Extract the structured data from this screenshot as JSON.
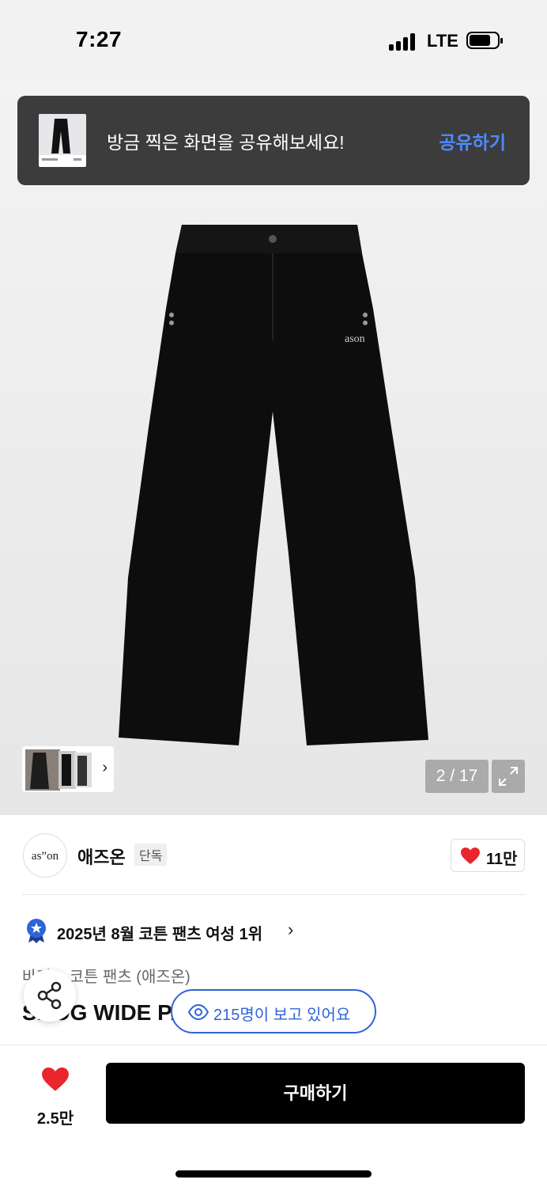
{
  "status_bar": {
    "time": "7:27",
    "network": "LTE"
  },
  "share_banner": {
    "message": "방금 찍은 화면을 공유해보세요!",
    "action": "공유하기"
  },
  "gallery": {
    "counter": "2 / 17",
    "logo_text": "ason"
  },
  "brand": {
    "logo_text": "as”on",
    "name": "애즈온",
    "badge": "단독",
    "likes": "11만"
  },
  "ranking": {
    "text": "2025년 8월 코튼 팬츠 여성 1위"
  },
  "category": {
    "text": "바지 > 코튼 팬츠 (애즈온)"
  },
  "product": {
    "name": "SNOG WIDE PANTS"
  },
  "viewers": {
    "text": "215명이 보고 있어요"
  },
  "bottom": {
    "wish_count": "2.5만",
    "buy_label": "구매하기"
  },
  "colors": {
    "accent_blue": "#2f63d8",
    "banner_action": "#4d8bff",
    "heart_red": "#e8262b"
  }
}
